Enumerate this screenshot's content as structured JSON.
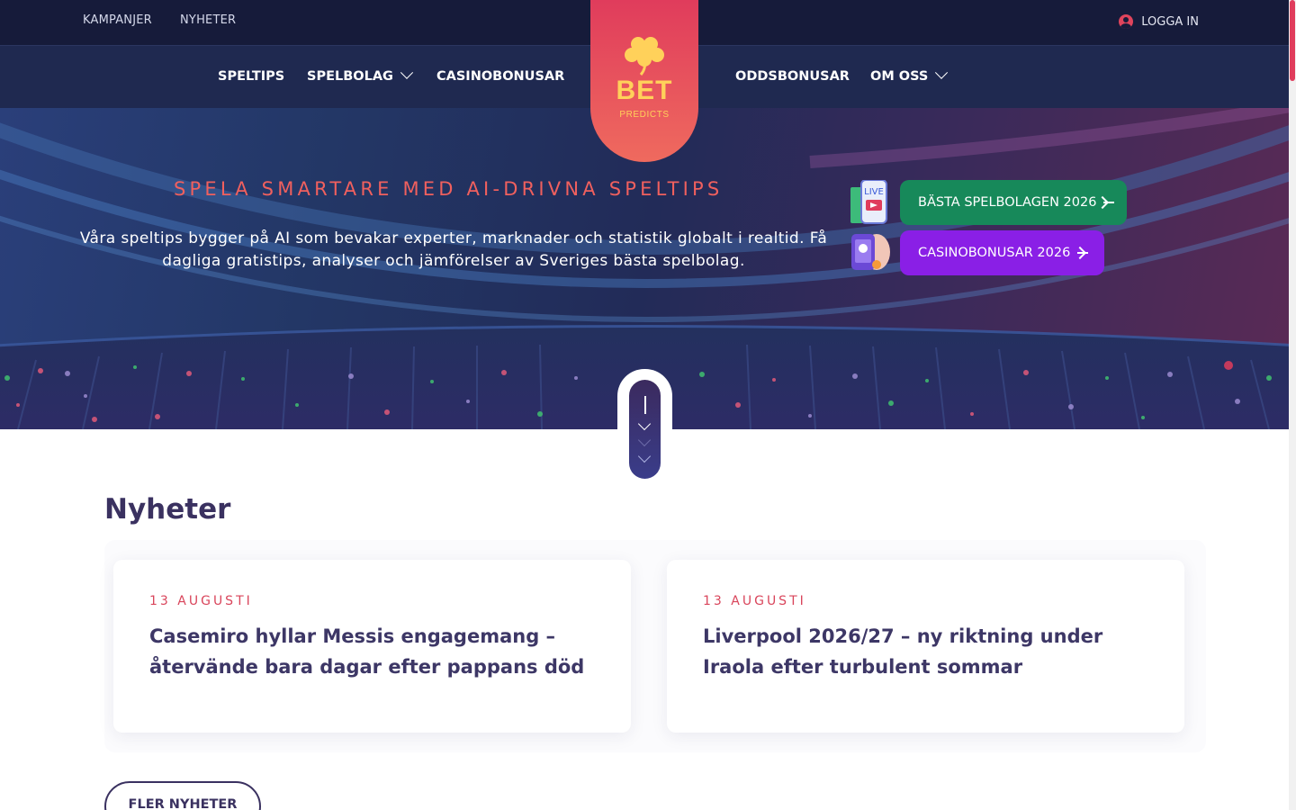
{
  "topbar": {
    "links": [
      "KAMPANJER",
      "NYHETER"
    ],
    "login_label": "LOGGA IN"
  },
  "nav": {
    "left": [
      {
        "label": "SPELTIPS",
        "dropdown": false
      },
      {
        "label": "SPELBOLAG",
        "dropdown": true
      },
      {
        "label": "CASINOBONUSAR",
        "dropdown": false
      }
    ],
    "right": [
      {
        "label": "ODDSBONUSAR",
        "dropdown": false
      },
      {
        "label": "OM OSS",
        "dropdown": true
      }
    ]
  },
  "logo": {
    "main": "BET",
    "sub": "PREDICTS"
  },
  "hero": {
    "title": "SPELA SMARTARE MED AI-DRIVNA SPELTIPS",
    "text": "Våra speltips bygger på AI som bevakar experter, marknader och statistik globalt i realtid. Få dagliga gratistips, analyser och jämförelser av Sveriges bästa spelbolag.",
    "cta_primary": "BÄSTA SPELBOLAGEN 2026",
    "cta_secondary": "CASINOBONUSAR 2026",
    "live_badge": "LIVE"
  },
  "news": {
    "heading": "Nyheter",
    "items": [
      {
        "date": "13 AUGUSTI",
        "title": "Casemiro hyllar Messis engagemang – återvände bara dagar efter pappans död"
      },
      {
        "date": "13 AUGUSTI",
        "title": "Liverpool 2026/27 – ny riktning under Iraola efter turbulent sommar"
      }
    ],
    "more_label": "FLER NYHETER"
  },
  "colors": {
    "topbar": "#161b3a",
    "navbar": "#1f2950",
    "accent": "#e03c5c",
    "cta_green": "#17895a",
    "cta_purple": "#8a1fe6",
    "heading": "#3a3160"
  },
  "icons": {
    "login": "user-circle-icon",
    "dropdown": "chevron-down-icon",
    "cta": "arrow-right-icon",
    "logo": "clover-icon"
  }
}
